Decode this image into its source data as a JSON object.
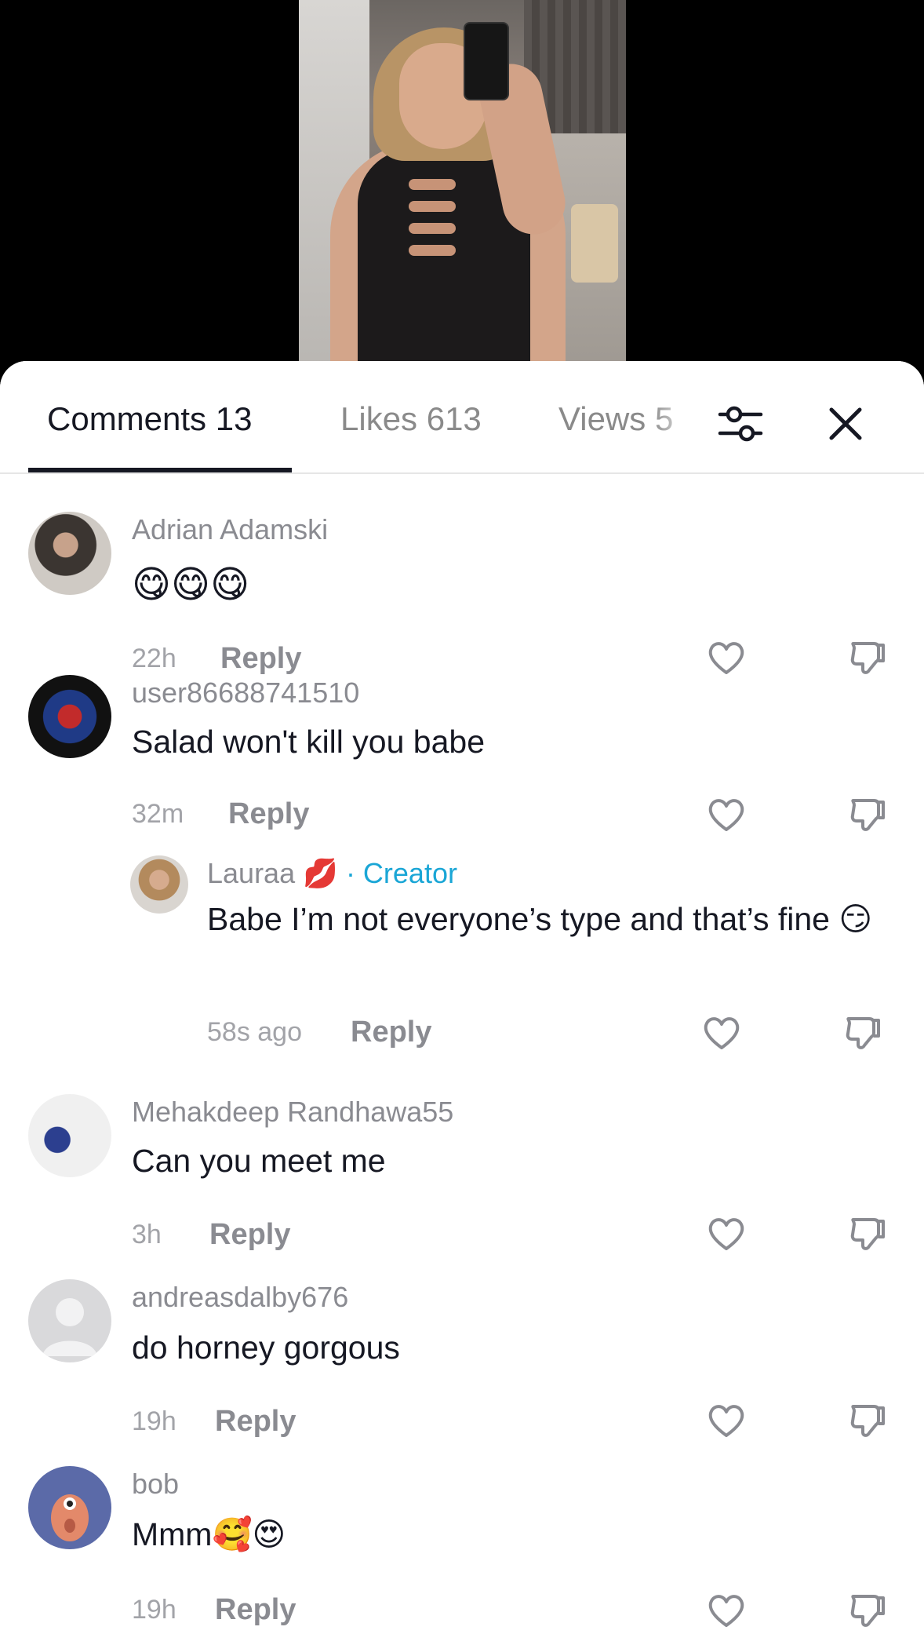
{
  "tabs": {
    "comments": "Comments 13",
    "likes": "Likes 613",
    "views": "Views 5"
  },
  "icons": {
    "filter": "filter-sliders-icon",
    "close": "close-x-icon",
    "heart": "heart-outline-icon",
    "dislike": "thumbs-down-icon"
  },
  "comments": [
    {
      "username": "Adrian Adamski",
      "text": "😋😋😋",
      "time": "22h",
      "reply": "Reply"
    },
    {
      "username": "user86688741510",
      "text": "Salad won't kill you babe",
      "time": "32m",
      "reply": "Reply"
    },
    {
      "username": "Lauraa 💋",
      "badge": "· Creator",
      "text": "Babe I’m not everyone’s type and that’s fine 😏",
      "time": "58s ago",
      "reply": "Reply"
    },
    {
      "username": "Mehakdeep Randhawa55",
      "text": "Can you meet me",
      "time": "3h",
      "reply": "Reply"
    },
    {
      "username": "andreasdalby676",
      "text": "do horney gorgous",
      "time": "19h",
      "reply": "Reply"
    },
    {
      "username": "bob",
      "text": "Mmm🥰😍",
      "time": "19h",
      "reply": "Reply"
    }
  ],
  "colors": {
    "creator": "#1aa6d6",
    "text": "#161823",
    "muted": "#8a8b91"
  }
}
